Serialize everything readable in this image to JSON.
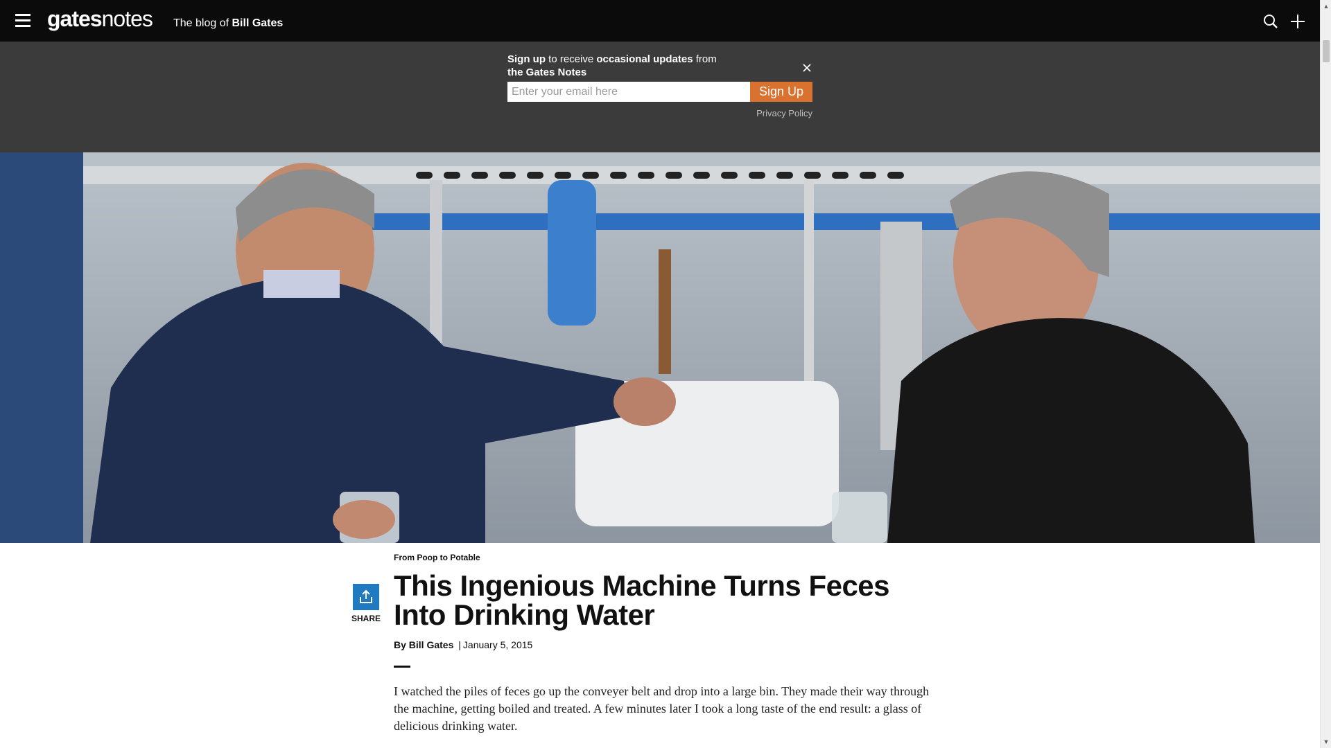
{
  "nav": {
    "logo_bold": "gates",
    "logo_light": "notes",
    "tagline_prefix": "The blog of ",
    "tagline_name": "Bill Gates"
  },
  "signup": {
    "text_b1": "Sign up",
    "text_1": " to receive ",
    "text_b2": "occasional updates",
    "text_2": " from ",
    "text_b3": "the Gates Notes",
    "email_placeholder": "Enter your email here",
    "button_label": "Sign Up",
    "privacy_label": "Privacy Policy"
  },
  "article": {
    "kicker": "From Poop to Potable",
    "title": "This Ingenious Machine Turns Feces Into Drinking Water",
    "byline_author": "By Bill Gates",
    "byline_sep": "|",
    "byline_date": "January 5, 2015",
    "body": "I watched the piles of feces go up the conveyer belt and drop into a large bin. They made their way through the machine, getting boiled and treated. A few minutes later I took a long taste of the end result: a glass of delicious drinking water."
  },
  "share": {
    "label": "SHARE"
  },
  "colors": {
    "topbar": "#0b0b0b",
    "signup_band": "#3b3b3b",
    "signup_button": "#d9722f",
    "share_icon": "#1f7ac2"
  }
}
